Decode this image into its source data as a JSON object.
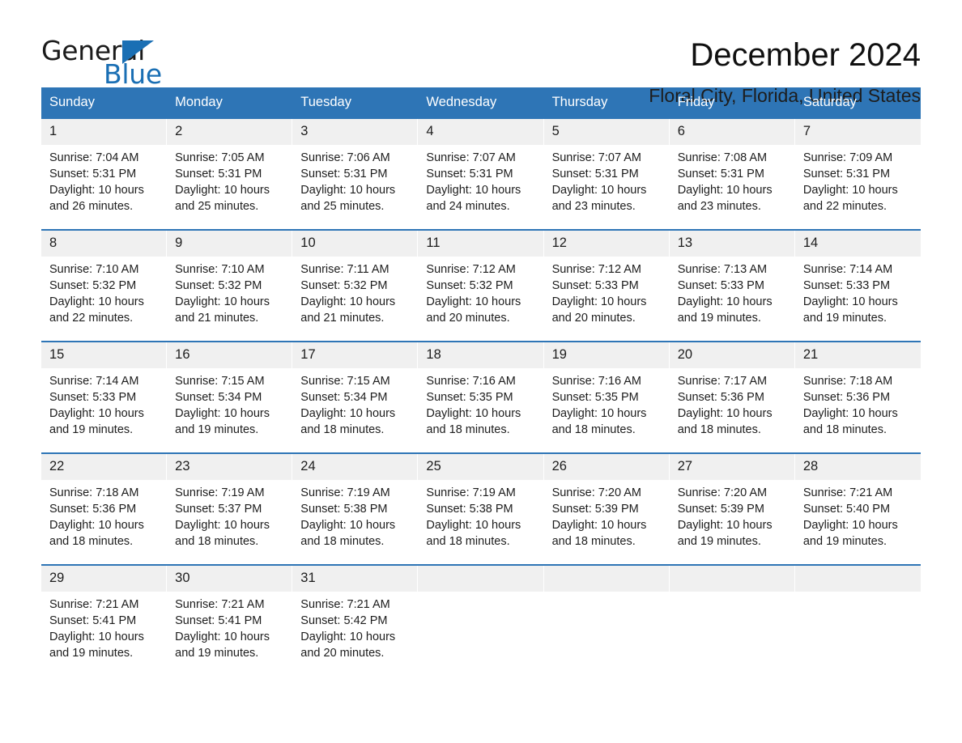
{
  "logo": {
    "word_one": "General",
    "word_two": "Blue",
    "triangle_color": "#1a6fb4",
    "icon": "general-blue-triangle-icon"
  },
  "header": {
    "month_title": "December 2024",
    "location": "Floral City, Florida, United States"
  },
  "theme": {
    "header_blue": "#2e75b6",
    "date_band": "#f0f0f0",
    "text": "#1d1d1d"
  },
  "calendar": {
    "day_names": [
      "Sunday",
      "Monday",
      "Tuesday",
      "Wednesday",
      "Thursday",
      "Friday",
      "Saturday"
    ],
    "weeks": [
      [
        {
          "date": "1",
          "sunrise": "Sunrise: 7:04 AM",
          "sunset": "Sunset: 5:31 PM",
          "daylight": "Daylight: 10 hours and 26 minutes."
        },
        {
          "date": "2",
          "sunrise": "Sunrise: 7:05 AM",
          "sunset": "Sunset: 5:31 PM",
          "daylight": "Daylight: 10 hours and 25 minutes."
        },
        {
          "date": "3",
          "sunrise": "Sunrise: 7:06 AM",
          "sunset": "Sunset: 5:31 PM",
          "daylight": "Daylight: 10 hours and 25 minutes."
        },
        {
          "date": "4",
          "sunrise": "Sunrise: 7:07 AM",
          "sunset": "Sunset: 5:31 PM",
          "daylight": "Daylight: 10 hours and 24 minutes."
        },
        {
          "date": "5",
          "sunrise": "Sunrise: 7:07 AM",
          "sunset": "Sunset: 5:31 PM",
          "daylight": "Daylight: 10 hours and 23 minutes."
        },
        {
          "date": "6",
          "sunrise": "Sunrise: 7:08 AM",
          "sunset": "Sunset: 5:31 PM",
          "daylight": "Daylight: 10 hours and 23 minutes."
        },
        {
          "date": "7",
          "sunrise": "Sunrise: 7:09 AM",
          "sunset": "Sunset: 5:31 PM",
          "daylight": "Daylight: 10 hours and 22 minutes."
        }
      ],
      [
        {
          "date": "8",
          "sunrise": "Sunrise: 7:10 AM",
          "sunset": "Sunset: 5:32 PM",
          "daylight": "Daylight: 10 hours and 22 minutes."
        },
        {
          "date": "9",
          "sunrise": "Sunrise: 7:10 AM",
          "sunset": "Sunset: 5:32 PM",
          "daylight": "Daylight: 10 hours and 21 minutes."
        },
        {
          "date": "10",
          "sunrise": "Sunrise: 7:11 AM",
          "sunset": "Sunset: 5:32 PM",
          "daylight": "Daylight: 10 hours and 21 minutes."
        },
        {
          "date": "11",
          "sunrise": "Sunrise: 7:12 AM",
          "sunset": "Sunset: 5:32 PM",
          "daylight": "Daylight: 10 hours and 20 minutes."
        },
        {
          "date": "12",
          "sunrise": "Sunrise: 7:12 AM",
          "sunset": "Sunset: 5:33 PM",
          "daylight": "Daylight: 10 hours and 20 minutes."
        },
        {
          "date": "13",
          "sunrise": "Sunrise: 7:13 AM",
          "sunset": "Sunset: 5:33 PM",
          "daylight": "Daylight: 10 hours and 19 minutes."
        },
        {
          "date": "14",
          "sunrise": "Sunrise: 7:14 AM",
          "sunset": "Sunset: 5:33 PM",
          "daylight": "Daylight: 10 hours and 19 minutes."
        }
      ],
      [
        {
          "date": "15",
          "sunrise": "Sunrise: 7:14 AM",
          "sunset": "Sunset: 5:33 PM",
          "daylight": "Daylight: 10 hours and 19 minutes."
        },
        {
          "date": "16",
          "sunrise": "Sunrise: 7:15 AM",
          "sunset": "Sunset: 5:34 PM",
          "daylight": "Daylight: 10 hours and 19 minutes."
        },
        {
          "date": "17",
          "sunrise": "Sunrise: 7:15 AM",
          "sunset": "Sunset: 5:34 PM",
          "daylight": "Daylight: 10 hours and 18 minutes."
        },
        {
          "date": "18",
          "sunrise": "Sunrise: 7:16 AM",
          "sunset": "Sunset: 5:35 PM",
          "daylight": "Daylight: 10 hours and 18 minutes."
        },
        {
          "date": "19",
          "sunrise": "Sunrise: 7:16 AM",
          "sunset": "Sunset: 5:35 PM",
          "daylight": "Daylight: 10 hours and 18 minutes."
        },
        {
          "date": "20",
          "sunrise": "Sunrise: 7:17 AM",
          "sunset": "Sunset: 5:36 PM",
          "daylight": "Daylight: 10 hours and 18 minutes."
        },
        {
          "date": "21",
          "sunrise": "Sunrise: 7:18 AM",
          "sunset": "Sunset: 5:36 PM",
          "daylight": "Daylight: 10 hours and 18 minutes."
        }
      ],
      [
        {
          "date": "22",
          "sunrise": "Sunrise: 7:18 AM",
          "sunset": "Sunset: 5:36 PM",
          "daylight": "Daylight: 10 hours and 18 minutes."
        },
        {
          "date": "23",
          "sunrise": "Sunrise: 7:19 AM",
          "sunset": "Sunset: 5:37 PM",
          "daylight": "Daylight: 10 hours and 18 minutes."
        },
        {
          "date": "24",
          "sunrise": "Sunrise: 7:19 AM",
          "sunset": "Sunset: 5:38 PM",
          "daylight": "Daylight: 10 hours and 18 minutes."
        },
        {
          "date": "25",
          "sunrise": "Sunrise: 7:19 AM",
          "sunset": "Sunset: 5:38 PM",
          "daylight": "Daylight: 10 hours and 18 minutes."
        },
        {
          "date": "26",
          "sunrise": "Sunrise: 7:20 AM",
          "sunset": "Sunset: 5:39 PM",
          "daylight": "Daylight: 10 hours and 18 minutes."
        },
        {
          "date": "27",
          "sunrise": "Sunrise: 7:20 AM",
          "sunset": "Sunset: 5:39 PM",
          "daylight": "Daylight: 10 hours and 19 minutes."
        },
        {
          "date": "28",
          "sunrise": "Sunrise: 7:21 AM",
          "sunset": "Sunset: 5:40 PM",
          "daylight": "Daylight: 10 hours and 19 minutes."
        }
      ],
      [
        {
          "date": "29",
          "sunrise": "Sunrise: 7:21 AM",
          "sunset": "Sunset: 5:41 PM",
          "daylight": "Daylight: 10 hours and 19 minutes."
        },
        {
          "date": "30",
          "sunrise": "Sunrise: 7:21 AM",
          "sunset": "Sunset: 5:41 PM",
          "daylight": "Daylight: 10 hours and 19 minutes."
        },
        {
          "date": "31",
          "sunrise": "Sunrise: 7:21 AM",
          "sunset": "Sunset: 5:42 PM",
          "daylight": "Daylight: 10 hours and 20 minutes."
        },
        {
          "date": "",
          "sunrise": "",
          "sunset": "",
          "daylight": ""
        },
        {
          "date": "",
          "sunrise": "",
          "sunset": "",
          "daylight": ""
        },
        {
          "date": "",
          "sunrise": "",
          "sunset": "",
          "daylight": ""
        },
        {
          "date": "",
          "sunrise": "",
          "sunset": "",
          "daylight": ""
        }
      ]
    ]
  }
}
